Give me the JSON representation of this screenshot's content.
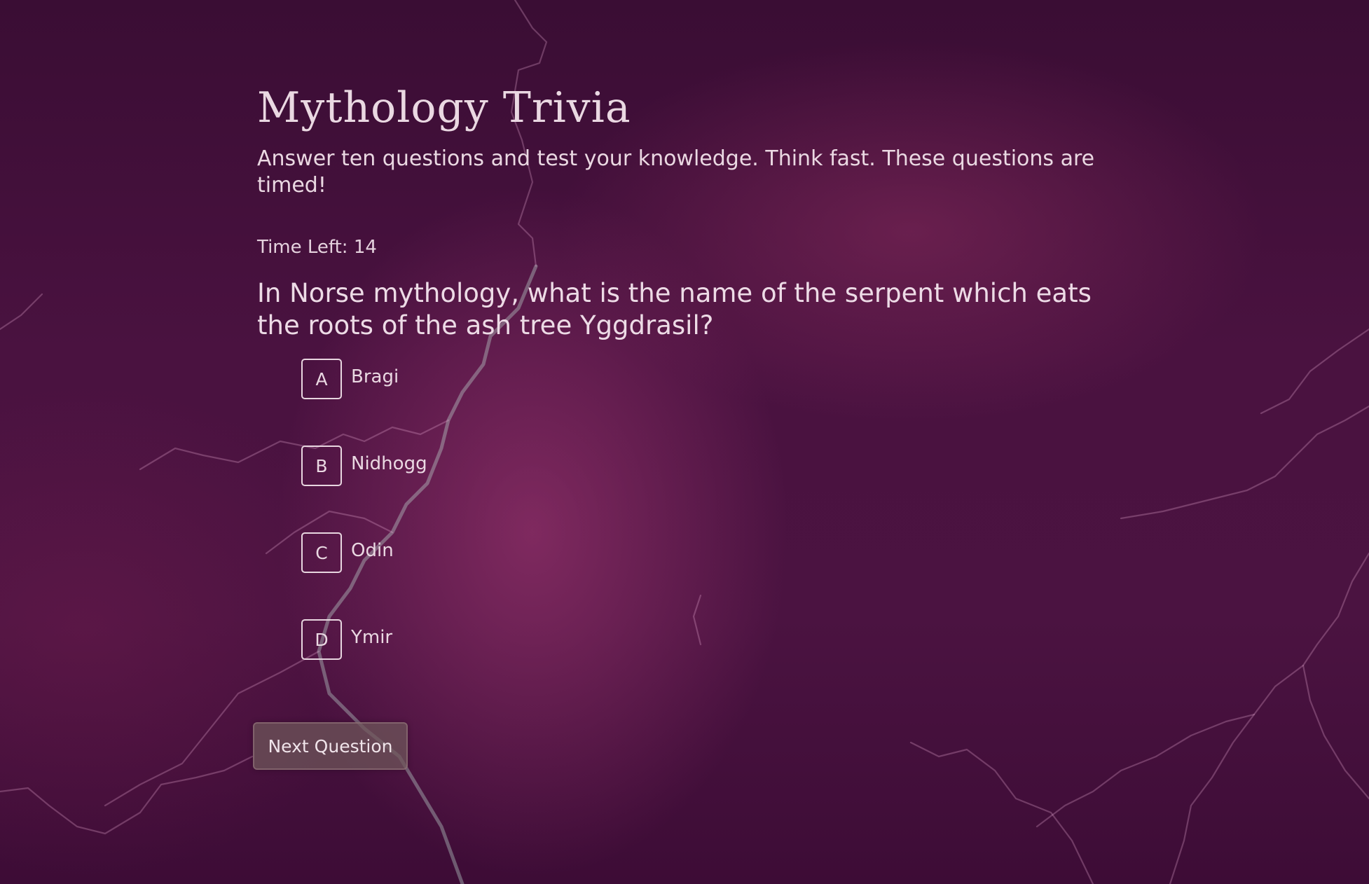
{
  "header": {
    "title": "Mythology Trivia",
    "subtitle": "Answer ten questions and test your knowledge. Think fast. These questions are timed!"
  },
  "timer": {
    "text": "Time Left: 14"
  },
  "question": {
    "text": "In Norse mythology, what is the name of the serpent which eats the roots of the ash tree Yggdrasil?"
  },
  "answers": [
    {
      "letter": "A",
      "text": "Bragi"
    },
    {
      "letter": "B",
      "text": "Nidhogg"
    },
    {
      "letter": "C",
      "text": "Odin"
    },
    {
      "letter": "D",
      "text": "Ymir"
    }
  ],
  "actions": {
    "next_label": "Next Question"
  },
  "theme": {
    "background": "#4a1240",
    "text": "#ead8e2",
    "button_bg": "#6e555a"
  }
}
